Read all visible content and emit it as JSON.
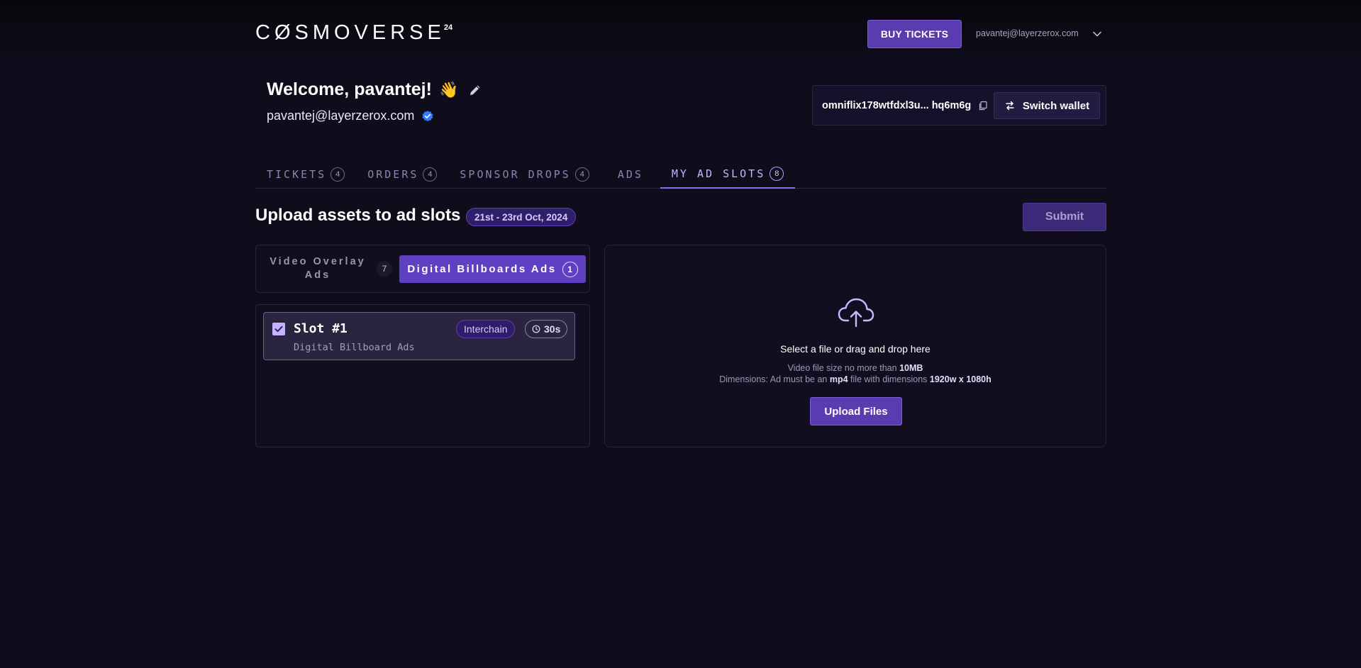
{
  "header": {
    "logo_text": "CØSMOVERSE",
    "logo_sup": "24",
    "buy_tickets_label": "BUY TICKETS",
    "user_email": "pavantej@layerzerox.com"
  },
  "profile": {
    "welcome": "Welcome, pavantej!",
    "wave_emoji": "👋",
    "email": "pavantej@layerzerox.com"
  },
  "wallet": {
    "address": "omniflix178wtfdxl3u... hq6m6g",
    "switch_label": "Switch wallet"
  },
  "tabs": [
    {
      "label": "TICKETS",
      "count": "4"
    },
    {
      "label": "ORDERS",
      "count": "4"
    },
    {
      "label": "SPONSOR DROPS",
      "count": "4"
    },
    {
      "label": "ADS",
      "count": ""
    },
    {
      "label": "MY AD SLOTS",
      "count": "8",
      "active": true
    }
  ],
  "section": {
    "title": "Upload assets to ad slots",
    "date_range": "21st - 23rd Oct, 2024",
    "submit_label": "Submit"
  },
  "subtabs": {
    "video": {
      "label": "Video Overlay Ads",
      "count": "7"
    },
    "billboard": {
      "label": "Digital Billboards Ads",
      "count": "1",
      "active": true
    }
  },
  "slot": {
    "title": "Slot #1",
    "subtitle": "Digital Billboard Ads",
    "tag": "Interchain",
    "duration": "30s",
    "checked": true
  },
  "upload": {
    "title": "Select a file or drag and drop here",
    "size_prefix": "Video file size no more than ",
    "size_value": "10MB",
    "dim_prefix": "Dimensions: Ad must be an ",
    "dim_format": "mp4",
    "dim_middle": " file with dimensions ",
    "dim_value": "1920w x 1080h",
    "button_label": "Upload Files"
  },
  "colors": {
    "background": "#0f0c1b",
    "accent": "#5a3bb0",
    "active_tab": "#c6b6ff",
    "verified": "#2f7bff"
  }
}
